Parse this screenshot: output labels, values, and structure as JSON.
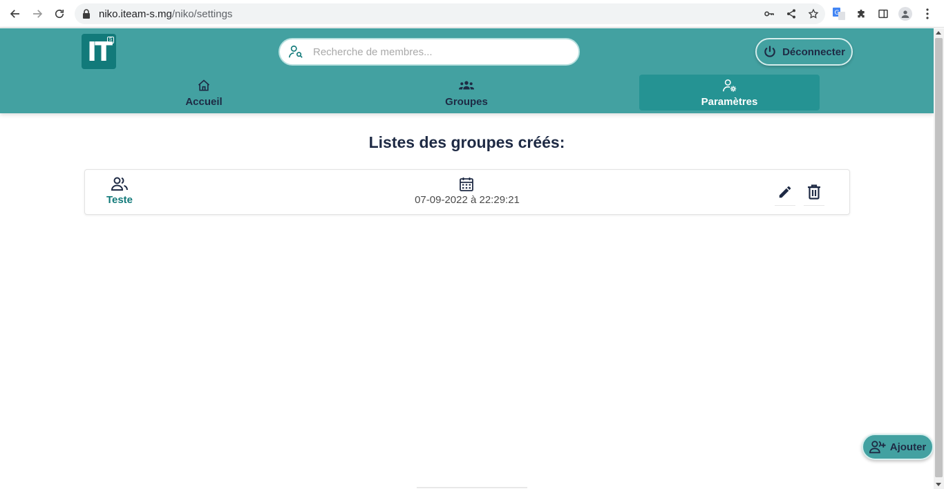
{
  "browser": {
    "url_host": "niko.iteam-s.mg",
    "url_path": "/niko/settings"
  },
  "header": {
    "logo_text": "IT",
    "logo_badge": "S",
    "search_placeholder": "Recherche de membres...",
    "logout_label": "Déconnecter",
    "tabs": [
      {
        "label": "Accueil",
        "icon": "home-icon",
        "active": false
      },
      {
        "label": "Groupes",
        "icon": "groups-icon",
        "active": false
      },
      {
        "label": "Paramètres",
        "icon": "user-settings-icon",
        "active": true
      }
    ]
  },
  "main": {
    "title": "Listes des groupes créés:",
    "groups": [
      {
        "name": "Teste",
        "created": "07-09-2022 à 22:29:21"
      }
    ]
  },
  "fab": {
    "label": "Ajouter",
    "icon": "add-user-icon"
  },
  "colors": {
    "header_bg": "#43a1a1",
    "active_tab_bg": "#259393",
    "logo_bg": "#127a7a",
    "text_dark": "#1e2a44",
    "accent_text": "#127a7a"
  }
}
